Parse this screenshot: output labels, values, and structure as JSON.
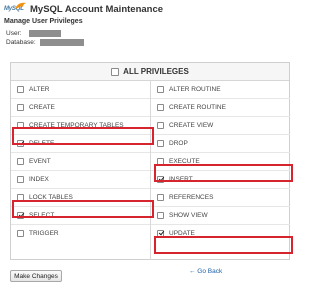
{
  "header": {
    "logo_text": "MySQL",
    "title": "MySQL Account Maintenance"
  },
  "section_title": "Manage User Privileges",
  "meta": {
    "user_label": "User:",
    "database_label": "Database:"
  },
  "privileges_header": {
    "label": "ALL PRIVILEGES",
    "checked": false
  },
  "privileges": {
    "left": [
      {
        "label": "ALTER",
        "checked": false
      },
      {
        "label": "CREATE",
        "checked": false
      },
      {
        "label": "CREATE TEMPORARY TABLES",
        "checked": false
      },
      {
        "label": "DELETE",
        "checked": true
      },
      {
        "label": "EVENT",
        "checked": false
      },
      {
        "label": "INDEX",
        "checked": false
      },
      {
        "label": "LOCK TABLES",
        "checked": false
      },
      {
        "label": "SELECT",
        "checked": true
      },
      {
        "label": "TRIGGER",
        "checked": false
      }
    ],
    "right": [
      {
        "label": "ALTER ROUTINE",
        "checked": false
      },
      {
        "label": "CREATE ROUTINE",
        "checked": false
      },
      {
        "label": "CREATE VIEW",
        "checked": false
      },
      {
        "label": "DROP",
        "checked": false
      },
      {
        "label": "EXECUTE",
        "checked": false
      },
      {
        "label": "INSERT",
        "checked": true
      },
      {
        "label": "REFERENCES",
        "checked": false
      },
      {
        "label": "SHOW VIEW",
        "checked": false
      },
      {
        "label": "UPDATE",
        "checked": true
      }
    ]
  },
  "highlight_color": "#d6252e",
  "buttons": {
    "make_changes": "Make Changes",
    "go_back": "← Go Back"
  }
}
